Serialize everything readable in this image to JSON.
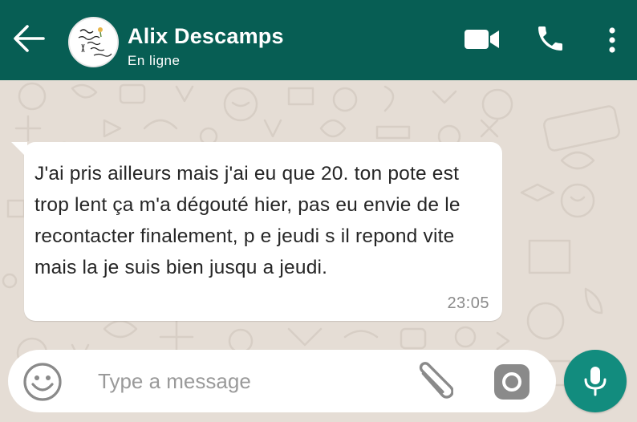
{
  "header": {
    "contact_name": "Alix Descamps",
    "status": "En ligne",
    "back_icon": "arrow-left-icon",
    "video_icon": "video-camera-icon",
    "call_icon": "phone-icon",
    "more_icon": "more-vertical-icon",
    "background_color": "#075e54"
  },
  "messages": [
    {
      "direction": "incoming",
      "text": "J'ai pris ailleurs mais j'ai eu que 20. ton pote est trop lent ça m'a dégouté hier, pas eu envie de le recontacter finalement, p e jeudi s il repond vite mais la je suis bien jusqu a jeudi.",
      "time": "23:05"
    }
  ],
  "composer": {
    "placeholder": "Type a message",
    "value": "",
    "emoji_icon": "emoji-icon",
    "attach_icon": "paperclip-icon",
    "camera_icon": "camera-icon",
    "mic_icon": "microphone-icon",
    "accent_color": "#128c7e"
  }
}
